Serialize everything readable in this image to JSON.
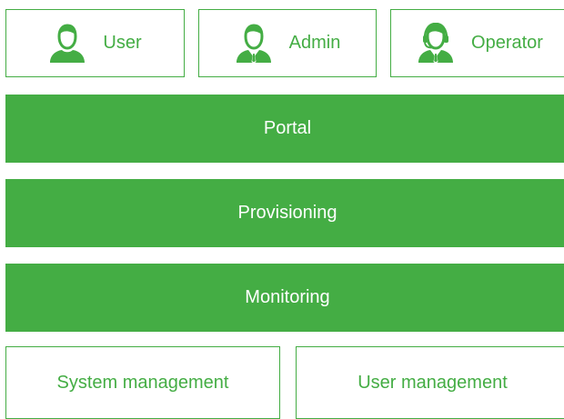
{
  "roles": [
    {
      "label": "User",
      "icon": "user-icon"
    },
    {
      "label": "Admin",
      "icon": "admin-icon"
    },
    {
      "label": "Operator",
      "icon": "operator-icon"
    }
  ],
  "layers": [
    {
      "label": "Portal"
    },
    {
      "label": "Provisioning"
    },
    {
      "label": "Monitoring"
    }
  ],
  "bottom": [
    {
      "label": "System management"
    },
    {
      "label": "User management"
    }
  ],
  "colors": {
    "accent": "#44ad44",
    "text_on_accent": "#ffffff",
    "background": "#ffffff"
  }
}
